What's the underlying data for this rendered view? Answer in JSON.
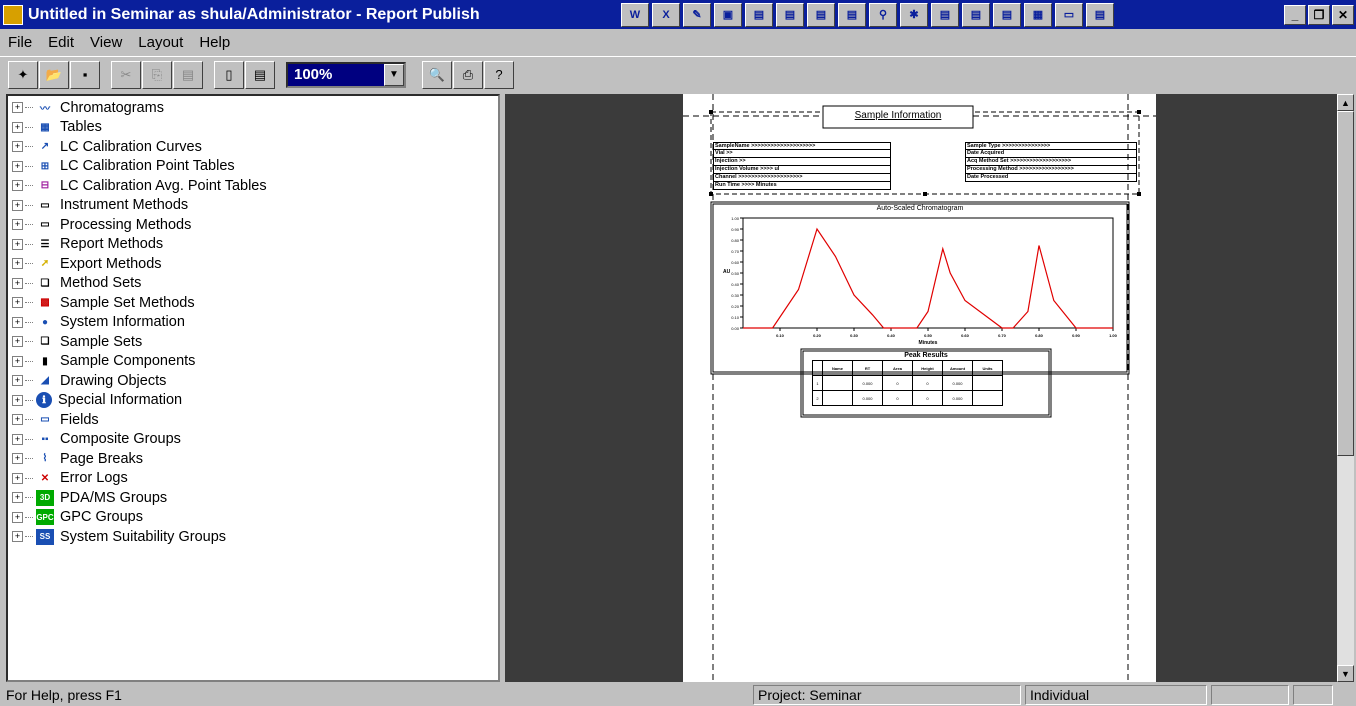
{
  "window": {
    "title": "Untitled in Seminar as shula/Administrator - Report Publish"
  },
  "menu": [
    "File",
    "Edit",
    "View",
    "Layout",
    "Help"
  ],
  "toolbar": {
    "zoom": "100%"
  },
  "tree": [
    {
      "label": "Chromatograms",
      "icon": "chromatogram-icon"
    },
    {
      "label": "Tables",
      "icon": "table-icon"
    },
    {
      "label": "LC Calibration Curves",
      "icon": "calibration-curve-icon"
    },
    {
      "label": "LC Calibration Point Tables",
      "icon": "calibration-point-table-icon"
    },
    {
      "label": "LC Calibration Avg. Point Tables",
      "icon": "calibration-avg-table-icon"
    },
    {
      "label": "Instrument Methods",
      "icon": "instrument-method-icon"
    },
    {
      "label": "Processing Methods",
      "icon": "processing-method-icon"
    },
    {
      "label": "Report Methods",
      "icon": "report-method-icon"
    },
    {
      "label": "Export Methods",
      "icon": "export-method-icon"
    },
    {
      "label": "Method Sets",
      "icon": "method-set-icon"
    },
    {
      "label": "Sample Set Methods",
      "icon": "sample-set-method-icon"
    },
    {
      "label": "System Information",
      "icon": "system-info-icon"
    },
    {
      "label": "Sample Sets",
      "icon": "sample-set-icon"
    },
    {
      "label": "Sample Components",
      "icon": "sample-component-icon"
    },
    {
      "label": "Drawing Objects",
      "icon": "drawing-object-icon"
    },
    {
      "label": "Special Information",
      "icon": "info-icon"
    },
    {
      "label": "Fields",
      "icon": "field-icon"
    },
    {
      "label": "Composite Groups",
      "icon": "composite-group-icon"
    },
    {
      "label": "Page Breaks",
      "icon": "page-break-icon"
    },
    {
      "label": "Error Logs",
      "icon": "error-log-icon"
    },
    {
      "label": "PDA/MS Groups",
      "icon": "pda-ms-icon"
    },
    {
      "label": "GPC Groups",
      "icon": "gpc-icon"
    },
    {
      "label": "System Suitability Groups",
      "icon": "system-suitability-icon"
    }
  ],
  "report": {
    "header_title": "Sample Information",
    "fields_left": [
      "SampleName >>>>>>>>>>>>>>>>>>>>",
      "Vial >>",
      "Injection >>",
      "Injection Volume >>>> ul",
      "Channel >>>>>>>>>>>>>>>>>>>>",
      "Run Time >>>> Minutes"
    ],
    "fields_right": [
      "Sample Type >>>>>>>>>>>>>>>",
      "Date Acquired",
      "Acq Method Set >>>>>>>>>>>>>>>>>>>",
      "Processing Method >>>>>>>>>>>>>>>>>",
      "Date Processed"
    ],
    "chart_title": "Auto-Scaled Chromatogram",
    "chart_xlabel": "Minutes",
    "chart_ylabel": "AU",
    "y_ticks": [
      "1.00",
      "0.90",
      "0.80",
      "0.70",
      "0.60",
      "0.50",
      "0.40",
      "0.30",
      "0.20",
      "0.10",
      "0.00"
    ],
    "x_ticks": [
      "0.10",
      "0.20",
      "0.30",
      "0.40",
      "0.50",
      "0.60",
      "0.70",
      "0.80",
      "0.90",
      "1.00"
    ],
    "table_title": "Peak Results",
    "table_headers": [
      "",
      "Name",
      "RT",
      "Area",
      "Height",
      "Amount",
      "Units"
    ],
    "table_rows": [
      [
        "1",
        "",
        "0.000",
        "0",
        "0",
        "0.000",
        ""
      ],
      [
        "2",
        "",
        "0.000",
        "0",
        "0",
        "0.000",
        ""
      ]
    ]
  },
  "chart_data": {
    "type": "line",
    "title": "Auto-Scaled Chromatogram",
    "xlabel": "Minutes",
    "ylabel": "AU",
    "xlim": [
      0.0,
      1.0
    ],
    "ylim": [
      0.0,
      1.0
    ],
    "x": [
      0.0,
      0.08,
      0.15,
      0.2,
      0.25,
      0.3,
      0.35,
      0.38,
      0.43,
      0.47,
      0.5,
      0.54,
      0.56,
      0.6,
      0.7,
      0.73,
      0.77,
      0.8,
      0.82,
      0.84,
      0.9,
      1.0
    ],
    "series": [
      {
        "values": [
          0.0,
          0.0,
          0.35,
          0.9,
          0.65,
          0.3,
          0.12,
          0.0,
          0.0,
          0.0,
          0.15,
          0.72,
          0.5,
          0.25,
          0.0,
          0.0,
          0.15,
          0.75,
          0.5,
          0.25,
          0.0,
          0.0
        ]
      }
    ]
  },
  "status": {
    "help": "For Help, press F1",
    "project": "Project: Seminar",
    "mode": "Individual"
  }
}
